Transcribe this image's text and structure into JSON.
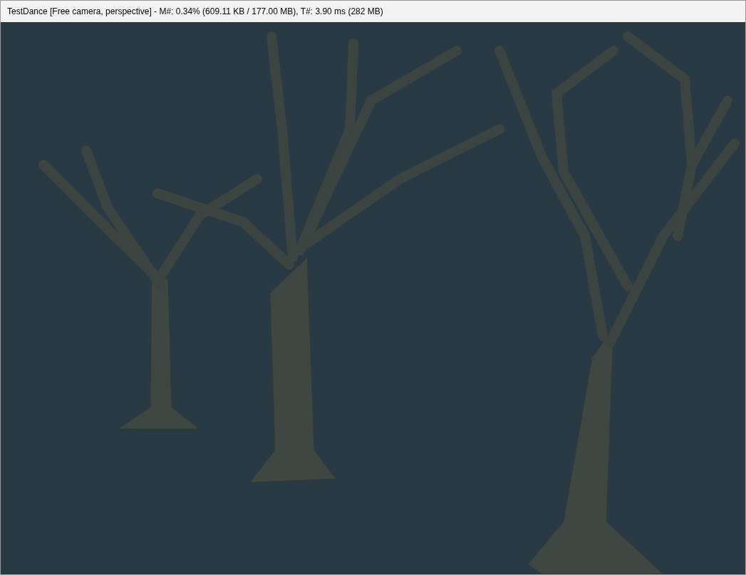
{
  "window": {
    "title": "TestDance [Free camera, perspective] - M#: 0.34% (609.11 KB / 177.00 MB), T#: 3.90 ms (282 MB)"
  }
}
